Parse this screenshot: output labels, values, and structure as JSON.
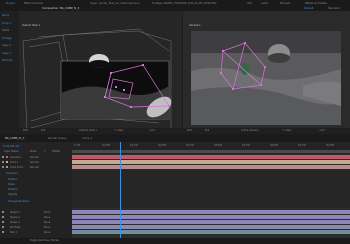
{
  "window": {
    "title": "Adobe After Effects"
  },
  "top_bar": {
    "left_tab": "Project",
    "tabs": [
      "Effect Controls",
      "Composition: BG_COMP_fx_3",
      "Layer: render_final_v2_rotoscope.mov",
      "Footage: BG001_FOOTAGE_CAM_B_v03_DEN.MOV"
    ],
    "right_tabs": [
      "Info",
      "Audio",
      "Preview",
      "Effects & Presets"
    ],
    "workspace_buttons": [
      "Default",
      "Standard"
    ]
  },
  "left_viewer": {
    "label": "Custom View 1",
    "bottom_controls": [
      "50%",
      "Full",
      "Custom View 1",
      "1 View",
      "+0.0"
    ]
  },
  "right_viewer": {
    "label": "Camera 1",
    "bottom_controls": [
      "50%",
      "Full",
      "Active Camera",
      "1 View",
      "+0.0"
    ]
  },
  "project_panel": {
    "items": [
      "Name",
      "Comp 1",
      "Solids",
      "Footage",
      "Layer 2",
      "Layer 3",
      "Precomp"
    ]
  },
  "timeline": {
    "tab_label": "BG_COMP_fx_3",
    "extra_tabs": [
      "Render Queue",
      "Comp 1"
    ],
    "timecode": "0;00;02;14",
    "ruler_marks": [
      "0:15f",
      "01:00f",
      "01:15f",
      "02:00f",
      "02:15f",
      "03:00f",
      "03:15f",
      "04:00f",
      "04:15f",
      "05:00f"
    ],
    "column_headers": [
      "Layer Name",
      "Mode",
      "T",
      "TrkMat"
    ],
    "layers": [
      {
        "name": "Camera 1",
        "mode": "Normal",
        "color": "#c05a6a"
      },
      {
        "name": "Solid 1",
        "mode": "Normal",
        "color": "#c7a98f"
      },
      {
        "name": "Track Point",
        "mode": "Normal",
        "color": "#b98c8c"
      }
    ],
    "properties": [
      "Transform",
      "Position",
      "Scale",
      "Rotation",
      "Opacity"
    ],
    "property_links": [
      "Change Renderer..."
    ],
    "bottom_layers": [
      {
        "name": "Shape 1",
        "mode": "None"
      },
      {
        "name": "Shape 2",
        "mode": "None"
      },
      {
        "name": "Shape 3",
        "mode": "None"
      },
      {
        "name": "BG Plate",
        "mode": "None"
      },
      {
        "name": "Null 1",
        "mode": "None"
      }
    ],
    "bottom_bar": "Toggle Switches / Modes"
  },
  "colors": {
    "accent_blue": "#3d8fe0",
    "track_pink": "#c05a6a",
    "track_tan": "#c7a98f",
    "track_lavender": "#8c86b9",
    "track_teal": "#6d8f95",
    "mask_magenta": "#d874d8"
  }
}
